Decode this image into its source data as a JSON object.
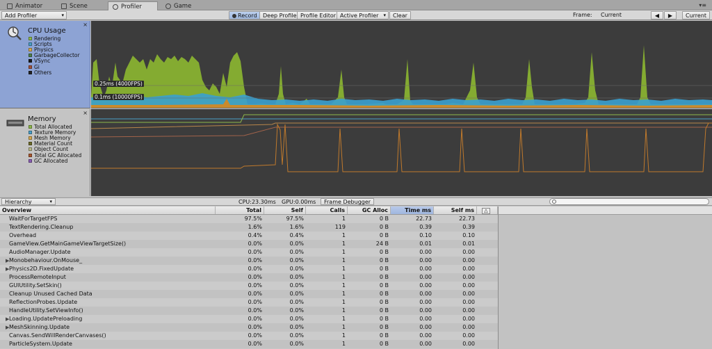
{
  "tabs": [
    {
      "label": "Animator",
      "active": false
    },
    {
      "label": "Scene",
      "active": false
    },
    {
      "label": "Profiler",
      "active": true
    },
    {
      "label": "Game",
      "active": false
    }
  ],
  "window_menu": "▾≡",
  "toolbar": {
    "add_profiler": "Add Profiler",
    "record": "Record",
    "deep_profile": "Deep Profile",
    "profile_editor": "Profile Editor",
    "active_profiler": "Active Profiler",
    "clear": "Clear",
    "frame_label": "Frame:",
    "frame_value": "Current",
    "prev": "◀",
    "next": "▶",
    "current": "Current"
  },
  "cpu_module": {
    "title": "CPU Usage",
    "close": "×",
    "legend": [
      {
        "name": "Rendering",
        "color": "#8eb84a"
      },
      {
        "name": "Scripts",
        "color": "#4a9fc8"
      },
      {
        "name": "Physics",
        "color": "#d6a84e"
      },
      {
        "name": "GarbageCollector",
        "color": "#4f7f4a"
      },
      {
        "name": "VSync",
        "color": "#1a1a1a"
      },
      {
        "name": "Gi",
        "color": "#a0523a"
      },
      {
        "name": "Others",
        "color": "#222222"
      }
    ],
    "label_25": "0.25ms (4000FPS)",
    "label_1": "0.1ms (10000FPS)"
  },
  "memory_module": {
    "title": "Memory",
    "close": "×",
    "legend": [
      {
        "name": "Total Allocated",
        "color": "#8eb84a"
      },
      {
        "name": "Texture Memory",
        "color": "#4a9fc8"
      },
      {
        "name": "Mesh Memory",
        "color": "#d6a84e"
      },
      {
        "name": "Material Count",
        "color": "#6d6b2a"
      },
      {
        "name": "Object Count",
        "color": "#b9b98a"
      },
      {
        "name": "Total GC Allocated",
        "color": "#a8572e"
      },
      {
        "name": "GC Allocated",
        "color": "#8a5fb3"
      }
    ]
  },
  "bottom_bar": {
    "view_mode": "Hierarchy",
    "cpu_time": "CPU:23.30ms",
    "gpu_time": "GPU:0.00ms",
    "frame_debugger": "Frame Debugger"
  },
  "table": {
    "columns": [
      "Overview",
      "Total",
      "Self",
      "Calls",
      "GC Alloc",
      "Time ms",
      "Self ms"
    ],
    "rows": [
      {
        "name": "WaitForTargetFPS",
        "expand": false,
        "total": "97.5%",
        "self": "97.5%",
        "calls": "1",
        "gc": "0 B",
        "time": "22.73",
        "selfms": "22.73"
      },
      {
        "name": "TextRendering.Cleanup",
        "expand": false,
        "total": "1.6%",
        "self": "1.6%",
        "calls": "119",
        "gc": "0 B",
        "time": "0.39",
        "selfms": "0.39"
      },
      {
        "name": "Overhead",
        "expand": false,
        "total": "0.4%",
        "self": "0.4%",
        "calls": "1",
        "gc": "0 B",
        "time": "0.10",
        "selfms": "0.10"
      },
      {
        "name": "GameView.GetMainGameViewTargetSize()",
        "expand": false,
        "total": "0.0%",
        "self": "0.0%",
        "calls": "1",
        "gc": "24 B",
        "time": "0.01",
        "selfms": "0.01"
      },
      {
        "name": "AudioManager.Update",
        "expand": false,
        "total": "0.0%",
        "self": "0.0%",
        "calls": "1",
        "gc": "0 B",
        "time": "0.00",
        "selfms": "0.00"
      },
      {
        "name": "Monobehaviour.OnMouse_",
        "expand": true,
        "total": "0.0%",
        "self": "0.0%",
        "calls": "1",
        "gc": "0 B",
        "time": "0.00",
        "selfms": "0.00"
      },
      {
        "name": "Physics2D.FixedUpdate",
        "expand": true,
        "total": "0.0%",
        "self": "0.0%",
        "calls": "1",
        "gc": "0 B",
        "time": "0.00",
        "selfms": "0.00"
      },
      {
        "name": "ProcessRemoteInput",
        "expand": false,
        "total": "0.0%",
        "self": "0.0%",
        "calls": "1",
        "gc": "0 B",
        "time": "0.00",
        "selfms": "0.00"
      },
      {
        "name": "GUIUtility.SetSkin()",
        "expand": false,
        "total": "0.0%",
        "self": "0.0%",
        "calls": "1",
        "gc": "0 B",
        "time": "0.00",
        "selfms": "0.00"
      },
      {
        "name": "Cleanup Unused Cached Data",
        "expand": false,
        "total": "0.0%",
        "self": "0.0%",
        "calls": "1",
        "gc": "0 B",
        "time": "0.00",
        "selfms": "0.00"
      },
      {
        "name": "ReflectionProbes.Update",
        "expand": false,
        "total": "0.0%",
        "self": "0.0%",
        "calls": "1",
        "gc": "0 B",
        "time": "0.00",
        "selfms": "0.00"
      },
      {
        "name": "HandleUtility.SetViewInfo()",
        "expand": false,
        "total": "0.0%",
        "self": "0.0%",
        "calls": "1",
        "gc": "0 B",
        "time": "0.00",
        "selfms": "0.00"
      },
      {
        "name": "Loading.UpdatePreloading",
        "expand": true,
        "total": "0.0%",
        "self": "0.0%",
        "calls": "1",
        "gc": "0 B",
        "time": "0.00",
        "selfms": "0.00"
      },
      {
        "name": "MeshSkinning.Update",
        "expand": true,
        "total": "0.0%",
        "self": "0.0%",
        "calls": "1",
        "gc": "0 B",
        "time": "0.00",
        "selfms": "0.00"
      },
      {
        "name": "Canvas.SendWillRenderCanvases()",
        "expand": false,
        "total": "0.0%",
        "self": "0.0%",
        "calls": "1",
        "gc": "0 B",
        "time": "0.00",
        "selfms": "0.00"
      },
      {
        "name": "ParticleSystem.Update",
        "expand": false,
        "total": "0.0%",
        "self": "0.0%",
        "calls": "1",
        "gc": "0 B",
        "time": "0.00",
        "selfms": "0.00"
      }
    ]
  }
}
